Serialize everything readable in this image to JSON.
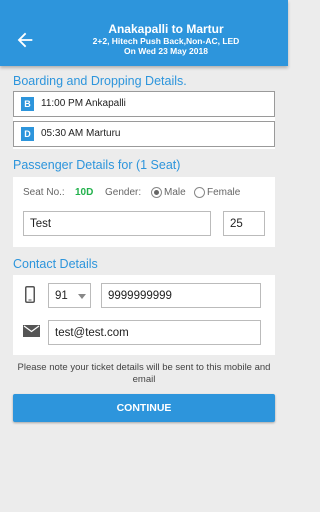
{
  "header": {
    "title": "Anakapalli to Martur",
    "bus_info": "2+2, Hitech Push Back,Non-AC, LED",
    "date": "On Wed 23 May 2018"
  },
  "boarding": {
    "section_title": "Boarding and Dropping Details.",
    "board_tag": "B",
    "board_text": "11:00 PM Ankapalli",
    "drop_tag": "D",
    "drop_text": "05:30 AM Marturu"
  },
  "passenger": {
    "section_title": "Passenger Details for (1 Seat)",
    "seat_label": "Seat No.:",
    "seat_value": "10D",
    "gender_label": "Gender:",
    "male_label": "Male",
    "female_label": "Female",
    "name_value": "Test",
    "age_value": "25"
  },
  "contact": {
    "section_title": "Contact Details",
    "country_code": "91",
    "phone_value": "9999999999",
    "email_value": "test@test.com"
  },
  "note": "Please note your ticket details will be sent to this mobile and email",
  "continue_label": "CONTINUE",
  "colors": {
    "primary": "#2d95dc",
    "seat_green": "#22b14c"
  }
}
